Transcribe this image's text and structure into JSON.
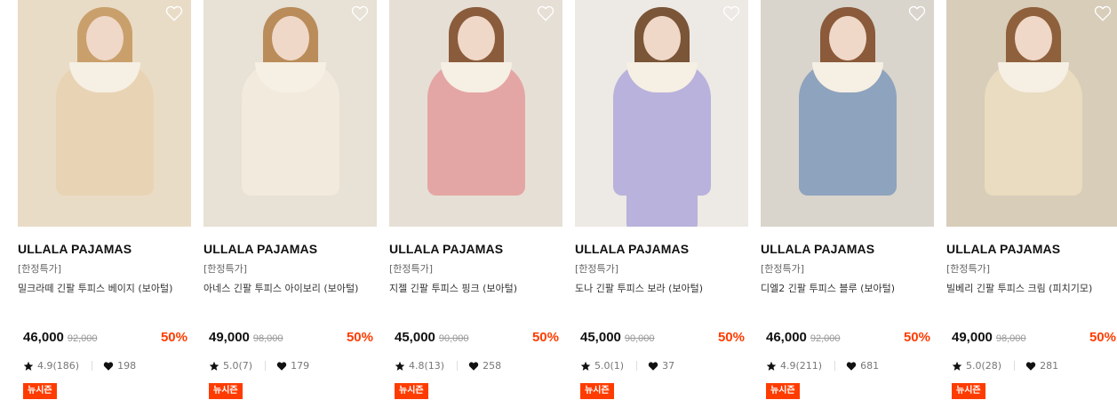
{
  "products": [
    {
      "brand": "ULLALA PAJAMAS",
      "tag": "[한정특가]",
      "name": "밀크라떼 긴팔 투피스 베이지 (보아털)",
      "price": "46,000",
      "original_price": "92,000",
      "discount": "50%",
      "rating": "4.9(186)",
      "likes": "198",
      "badge": "뉴시즌",
      "colors": {
        "bg": "#e9dcc6",
        "outfit": "#e8d4b4",
        "hair": "#c9a06c"
      }
    },
    {
      "brand": "ULLALA PAJAMAS",
      "tag": "[한정특가]",
      "name": "아네스 긴팔 투피스 아이보리 (보아털)",
      "price": "49,000",
      "original_price": "98,000",
      "discount": "50%",
      "rating": "5.0(7)",
      "likes": "179",
      "badge": "뉴시즌",
      "colors": {
        "bg": "#e7e1d6",
        "outfit": "#f2ebdd",
        "hair": "#b98c5a"
      }
    },
    {
      "brand": "ULLALA PAJAMAS",
      "tag": "[한정특가]",
      "name": "지젤 긴팔 투피스 핑크 (보아털)",
      "price": "45,000",
      "original_price": "90,000",
      "discount": "50%",
      "rating": "4.8(13)",
      "likes": "258",
      "badge": "뉴시즌",
      "colors": {
        "bg": "#e6dfd6",
        "outfit": "#e4a6a4",
        "hair": "#8a5c3c"
      }
    },
    {
      "brand": "ULLALA PAJAMAS",
      "tag": "[한정특가]",
      "name": "도나 긴팔 투피스 보라 (보아털)",
      "price": "45,000",
      "original_price": "90,000",
      "discount": "50%",
      "rating": "5.0(1)",
      "likes": "37",
      "badge": "뉴시즌",
      "colors": {
        "bg": "#ede9e4",
        "outfit": "#b9b2dc",
        "hair": "#7a5538"
      }
    },
    {
      "brand": "ULLALA PAJAMAS",
      "tag": "[한정특가]",
      "name": "디엘2 긴팔 투피스 블루 (보아털)",
      "price": "46,000",
      "original_price": "92,000",
      "discount": "50%",
      "rating": "4.9(211)",
      "likes": "681",
      "badge": "뉴시즌",
      "colors": {
        "bg": "#d9d5cd",
        "outfit": "#8ea3bd",
        "hair": "#8a5a3a"
      }
    },
    {
      "brand": "ULLALA PAJAMAS",
      "tag": "[한정특가]",
      "name": "빌베리 긴팔 투피스 크림 (피치기모)",
      "price": "49,000",
      "original_price": "98,000",
      "discount": "50%",
      "rating": "5.0(28)",
      "likes": "281",
      "badge": "뉴시즌",
      "colors": {
        "bg": "#d8cdb9",
        "outfit": "#e9dcc0",
        "hair": "#8e603c"
      }
    }
  ],
  "icons": {
    "wish": "heart-outline-icon",
    "rating": "star-icon",
    "likes": "heart-filled-icon"
  }
}
